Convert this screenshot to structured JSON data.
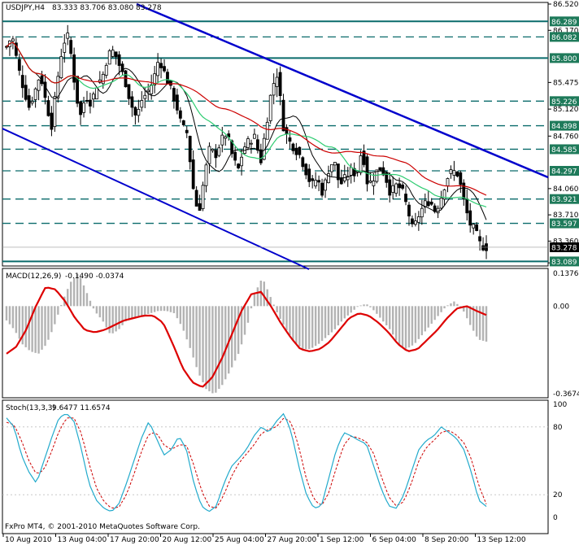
{
  "header": {
    "symbol": "USDJPY,H4",
    "ohlc": "83.333 83.706 83.080 83.278"
  },
  "macd_header": {
    "label": "MACD(12,26,9)",
    "values": "-0.1490 -0.0374"
  },
  "stoch_header": {
    "label": "Stoch(13,3,3)",
    "values": "9.6477 11.6574"
  },
  "footer": {
    "copyright": "FxPro MT4, © 2001-2010 MetaQuotes Software Corp."
  },
  "colors": {
    "background": "#ffffff",
    "candles": "#000000",
    "levels": "#0a6b6b",
    "trend_channel": "#0000cc",
    "ma_red": "#cc0000",
    "ma_green": "#2ecc71",
    "ma_black": "#000000",
    "macd_hist": "#b3b3b3",
    "macd_signal": "#dd0000",
    "stoch_main": "#22aacc",
    "stoch_signal": "#cc0000",
    "tag_bg": "#1e7a5a",
    "current_tag_bg": "#000000"
  },
  "chart_data": [
    {
      "type": "candlestick",
      "symbol": "USDJPY",
      "timeframe": "H4",
      "ylim": [
        83.05,
        86.52
      ],
      "y_ticks": [
        "86.520",
        "86.170",
        "85.475",
        "85.120",
        "84.760",
        "84.060",
        "83.710",
        "83.360",
        "83.070"
      ],
      "x_ticks": [
        "10 Aug 2010",
        "13 Aug 04:00",
        "17 Aug 20:00",
        "20 Aug 12:00",
        "25 Aug 04:00",
        "27 Aug 20:00",
        "1 Sep 12:00",
        "6 Sep 04:00",
        "8 Sep 20:00",
        "13 Sep 12:00"
      ],
      "horizontal_levels": [
        86.289,
        86.082,
        85.8,
        85.226,
        84.898,
        84.585,
        84.297,
        83.921,
        83.597,
        83.089
      ],
      "level_labels": [
        "86.289",
        "86.082",
        "85.800",
        "85.226",
        "84.898",
        "84.585",
        "84.297",
        "83.921",
        "83.597",
        "83.089"
      ],
      "current_price": 83.278,
      "current_price_label": "83.278",
      "close_path": [
        85.95,
        86.1,
        85.7,
        85.4,
        85.15,
        85.35,
        85.6,
        85.2,
        84.9,
        85.5,
        86.0,
        86.1,
        85.5,
        85.0,
        85.3,
        85.2,
        85.45,
        85.55,
        85.85,
        85.9,
        85.7,
        85.5,
        85.2,
        85.0,
        85.25,
        85.35,
        85.5,
        85.8,
        85.6,
        85.4,
        85.2,
        84.9,
        84.8,
        84.1,
        83.7,
        84.2,
        84.6,
        84.5,
        84.7,
        84.8,
        84.5,
        84.3,
        84.6,
        84.7,
        84.75,
        84.4,
        84.9,
        85.4,
        85.6,
        84.9,
        84.7,
        84.6,
        84.5,
        84.3,
        84.1,
        84.2,
        84.0,
        84.3,
        84.45,
        84.1,
        84.2,
        84.3,
        84.25,
        84.6,
        84.1,
        84.2,
        84.35,
        84.25,
        84.0,
        84.1,
        84.05,
        83.8,
        83.5,
        83.7,
        83.85,
        83.9,
        83.75,
        83.95,
        84.2,
        84.3,
        84.25,
        83.9,
        83.6,
        83.5,
        83.3,
        83.278
      ]
    },
    {
      "type": "macd",
      "params": "12,26,9",
      "ylim": [
        -0.3674,
        0.1376
      ],
      "y_ticks": [
        "0.1376",
        "0.00",
        "-0.3674"
      ],
      "histogram": [
        -0.06,
        -0.1,
        -0.16,
        -0.19,
        -0.2,
        -0.16,
        -0.08,
        0.02,
        0.1,
        0.14,
        0.06,
        -0.02,
        -0.06,
        -0.12,
        -0.1,
        -0.06,
        -0.05,
        -0.04,
        -0.03,
        -0.02,
        -0.02,
        -0.03,
        -0.09,
        -0.18,
        -0.28,
        -0.35,
        -0.37,
        -0.33,
        -0.27,
        -0.2,
        -0.1,
        0.05,
        0.12,
        0.04,
        -0.04,
        -0.1,
        -0.15,
        -0.18,
        -0.18,
        -0.16,
        -0.13,
        -0.1,
        -0.06,
        -0.03,
        0.0,
        0.01,
        -0.02,
        -0.06,
        -0.1,
        -0.16,
        -0.18,
        -0.16,
        -0.12,
        -0.08,
        -0.04,
        0.0,
        0.02,
        -0.01,
        -0.08,
        -0.14,
        -0.149
      ],
      "signal": [
        -0.2,
        -0.17,
        -0.1,
        0.0,
        0.08,
        0.07,
        0.02,
        -0.05,
        -0.1,
        -0.11,
        -0.1,
        -0.08,
        -0.06,
        -0.05,
        -0.04,
        -0.04,
        -0.07,
        -0.16,
        -0.26,
        -0.32,
        -0.34,
        -0.3,
        -0.22,
        -0.12,
        -0.02,
        0.05,
        0.06,
        0.0,
        -0.07,
        -0.13,
        -0.18,
        -0.19,
        -0.18,
        -0.15,
        -0.1,
        -0.05,
        -0.03,
        -0.04,
        -0.07,
        -0.11,
        -0.16,
        -0.19,
        -0.18,
        -0.14,
        -0.1,
        -0.05,
        -0.01,
        0.0,
        -0.02,
        -0.0374
      ]
    },
    {
      "type": "stochastic",
      "params": "13,3,3",
      "ylim": [
        0,
        100
      ],
      "y_ticks": [
        "100",
        "80",
        "20",
        "0"
      ],
      "main": [
        88,
        80,
        55,
        40,
        30,
        50,
        70,
        88,
        92,
        85,
        60,
        30,
        15,
        8,
        5,
        12,
        30,
        50,
        70,
        85,
        70,
        55,
        60,
        72,
        60,
        30,
        10,
        5,
        10,
        30,
        45,
        52,
        60,
        72,
        80,
        75,
        85,
        92,
        75,
        45,
        20,
        8,
        10,
        35,
        60,
        75,
        72,
        68,
        65,
        45,
        25,
        10,
        8,
        20,
        40,
        60,
        68,
        72,
        80,
        75,
        70,
        60,
        40,
        15,
        9.6477
      ],
      "signal": [
        84,
        82,
        68,
        50,
        38,
        42,
        58,
        76,
        88,
        88,
        74,
        48,
        26,
        14,
        8,
        9,
        20,
        38,
        58,
        74,
        75,
        64,
        60,
        64,
        64,
        46,
        24,
        10,
        8,
        20,
        36,
        48,
        56,
        64,
        74,
        78,
        80,
        88,
        84,
        62,
        34,
        16,
        10,
        22,
        44,
        64,
        72,
        70,
        67,
        56,
        36,
        18,
        10,
        14,
        30,
        50,
        62,
        68,
        75,
        77,
        73,
        66,
        52,
        28,
        11.6574
      ]
    }
  ]
}
